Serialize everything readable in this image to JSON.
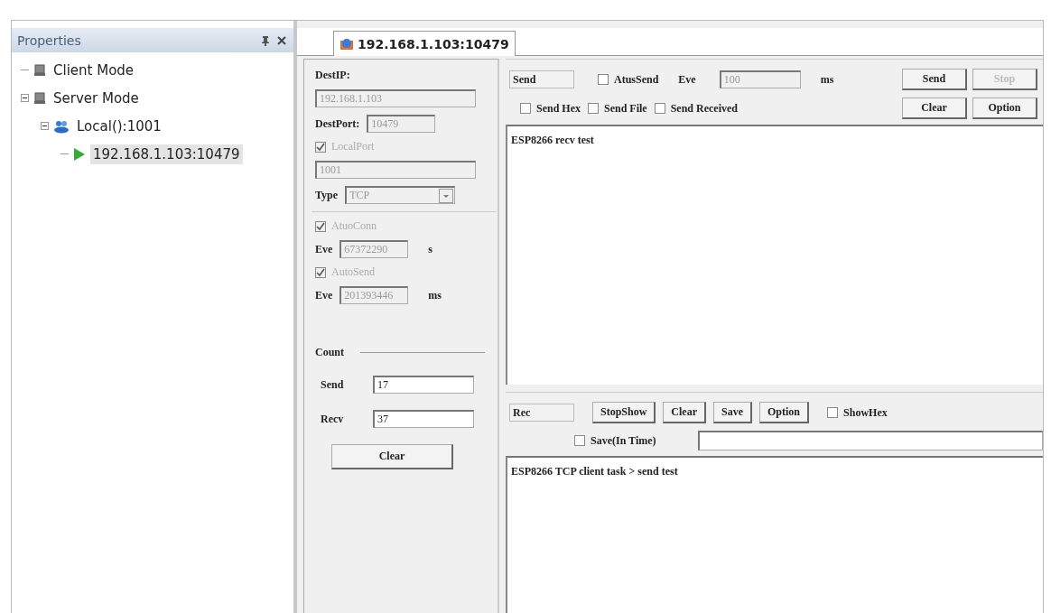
{
  "properties_panel": {
    "title": "Properties",
    "tree": [
      {
        "label": "Client Mode",
        "kind": "computer",
        "selected": false
      },
      {
        "label": "Server Mode",
        "kind": "computer",
        "expanded": true,
        "selected": false,
        "children": [
          {
            "label": "Local():1001",
            "kind": "network",
            "expanded": true,
            "selected": false,
            "children": [
              {
                "label": "192.168.1.103:10479",
                "kind": "play",
                "selected": true
              }
            ]
          }
        ]
      }
    ]
  },
  "tabs": [
    {
      "label": "192.168.1.103:10479",
      "selected": true
    }
  ],
  "connection": {
    "dest_ip_label": "DestIP:",
    "dest_ip": "192.168.1.103",
    "dest_port_label": "DestPort:",
    "dest_port": "10479",
    "local_port": {
      "label": "LocalPort",
      "checked": true,
      "disabled": true
    },
    "local_port_value": "1001",
    "type_label": "Type",
    "type_value": "TCP",
    "auto_conn": {
      "label": "AtuoConn",
      "checked": true,
      "disabled": true
    },
    "auto_conn_eve_label": "Eve",
    "auto_conn_eve": "67372290",
    "auto_conn_unit": "s",
    "auto_send": {
      "label": "AutoSend",
      "checked": true,
      "disabled": true
    },
    "auto_send_eve_label": "Eve",
    "auto_send_eve": "201393446",
    "auto_send_unit": "ms"
  },
  "count": {
    "title": "Count",
    "send_label": "Send",
    "send": "17",
    "recv_label": "Recv",
    "recv": "37",
    "clear_button": "Clear"
  },
  "send_panel": {
    "mode": "Send",
    "atus_send": {
      "label": "AtusSend",
      "checked": false,
      "disabled": false
    },
    "eve_label": "Eve",
    "eve": "100",
    "unit": "ms",
    "buttons": [
      {
        "label": "Send",
        "disabled": false
      },
      {
        "label": "Stop",
        "disabled": true
      }
    ],
    "options": [
      {
        "label": "Send Hex",
        "checked": false,
        "disabled": false
      },
      {
        "label": "Send File",
        "checked": false,
        "disabled": false
      },
      {
        "label": "Send Received",
        "checked": false,
        "disabled": false
      }
    ],
    "buttons_2": [
      {
        "label": "Clear",
        "disabled": false
      },
      {
        "label": "Option",
        "disabled": false
      }
    ],
    "text": "ESP8266 recv test"
  },
  "recv_panel": {
    "mode": "Rec",
    "buttons": [
      {
        "label": "StopShow",
        "disabled": false
      },
      {
        "label": "Clear",
        "disabled": false
      },
      {
        "label": "Save",
        "disabled": false
      },
      {
        "label": "Option",
        "disabled": false
      }
    ],
    "show_hex": {
      "label": "ShowHex",
      "checked": false,
      "disabled": false
    },
    "save_in_time": {
      "label": "Save(In Time)",
      "checked": false,
      "disabled": false
    },
    "text": "ESP8266 TCP client task > send test"
  }
}
